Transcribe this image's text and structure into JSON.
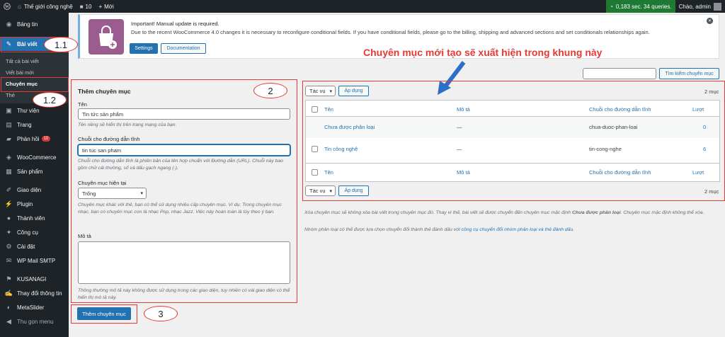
{
  "adminbar": {
    "site_name": "Thế giới công nghệ",
    "comments_count": "10",
    "new_label": "Mới",
    "perf": "0,183 sec. 34 queries.",
    "greeting": "Chào, admin"
  },
  "sidebar": {
    "items": [
      {
        "label": "Bảng tin",
        "icon": "dashboard-icon"
      },
      {
        "label": "Bài viết",
        "icon": "pin-icon"
      },
      {
        "label": "Thư viện",
        "icon": "media-icon"
      },
      {
        "label": "Trang",
        "icon": "page-icon"
      },
      {
        "label": "Phản hồi",
        "icon": "comment-icon",
        "badge": "10"
      },
      {
        "label": "WooCommerce",
        "icon": "woo-icon"
      },
      {
        "label": "Sản phẩm",
        "icon": "product-icon"
      },
      {
        "label": "Giao diện",
        "icon": "brush-icon"
      },
      {
        "label": "Plugin",
        "icon": "plugin-icon"
      },
      {
        "label": "Thành viên",
        "icon": "user-icon"
      },
      {
        "label": "Công cụ",
        "icon": "wrench-icon"
      },
      {
        "label": "Cài đặt",
        "icon": "settings-icon"
      },
      {
        "label": "WP Mail SMTP",
        "icon": "mail-icon"
      },
      {
        "label": "KUSANAGI",
        "icon": "kusanagi-icon"
      },
      {
        "label": "Thay đổi thông tin",
        "icon": "edit-icon"
      },
      {
        "label": "MetaSlider",
        "icon": "slider-icon"
      },
      {
        "label": "Thu gọn menu",
        "icon": "collapse-icon"
      }
    ],
    "submenu": [
      "Tất cả bài viết",
      "Viết bài mới",
      "Chuyên mục",
      "Thẻ"
    ]
  },
  "notice": {
    "title": "Important! Manual update is required.",
    "text": "Due to the recent WooCommerce 4.0 changes it is necessary to reconfigure conditional fields. If you have conditional fields, please go to the billing, shipping and advanced sections and set conditionals relationships again.",
    "settings_label": "Settings",
    "documentation_label": "Documentation"
  },
  "annotations": {
    "a11": "1.1",
    "a12": "1.2",
    "a2": "2",
    "a3": "3",
    "callout": "Chuyên mục mới tạo sẽ xuất hiện trong khung này"
  },
  "search": {
    "value": "",
    "button_label": "Tìm kiếm chuyên mục"
  },
  "form": {
    "heading": "Thêm chuyên mục",
    "name_label": "Tên",
    "name_value": "Tin tức sản phẩm",
    "name_help": "Tên riêng sẽ hiển thị trên trang mạng của bạn.",
    "slug_label": "Chuỗi cho đường dẫn tĩnh",
    "slug_value": "tin tuc san pham",
    "slug_help": "Chuỗi cho đường dẫn tĩnh là phiên bản của tên hợp chuẩn với Đường dẫn (URL). Chuỗi này bao gồm chữ cái thường, số và dấu gạch ngang (-).",
    "parent_label": "Chuyên mục hiện tại",
    "parent_value": "Trống",
    "parent_help": "Chuyên mục khác với thẻ, bạn có thể sử dụng nhiều cấp chuyên mục. Ví dụ: Trong chuyên mục nhạc, bạn có chuyên mục con là nhạc Pop, nhạc Jazz. Việc này hoàn toàn là tùy theo ý bạn.",
    "desc_label": "Mô tả",
    "desc_value": "",
    "desc_help": "Thông thường mô tả này không được sử dụng trong các giao diện, tuy nhiên có vài giao diện có thể hiển thị mô tả này.",
    "submit_label": "Thêm chuyên mục"
  },
  "table": {
    "bulk_label": "Tác vụ",
    "apply_label": "Áp dụng",
    "count": "2 mục",
    "headers": [
      "Tên",
      "Mô tả",
      "Chuỗi cho đường dẫn tĩnh",
      "Lượt"
    ],
    "rows": [
      {
        "name": "Chưa được phân loại",
        "desc": "—",
        "slug": "chua-duoc-phan-loai",
        "count": "0"
      },
      {
        "name": "Tin công nghệ",
        "desc": "—",
        "slug": "tin-cong-nghe",
        "count": "6"
      }
    ]
  },
  "footer_notes": {
    "note1_a": "Xóa chuyên mục sẽ không xóa bài viết trong chuyên mục đó. Thay vì thế, bài viết sẽ được chuyển đến chuyên mục mặc định",
    "note1_b": "Chưa được phân loại",
    "note1_c": ". Chuyên mục mặc định không thể xóa.",
    "note2_a": "Nhóm phân loại có thể được lựa chọn chuyển đổi thành thẻ đánh dấu với",
    "note2_link": "công cụ chuyển đổi nhóm phân loại và thẻ đánh dấu",
    "note2_b": "."
  }
}
